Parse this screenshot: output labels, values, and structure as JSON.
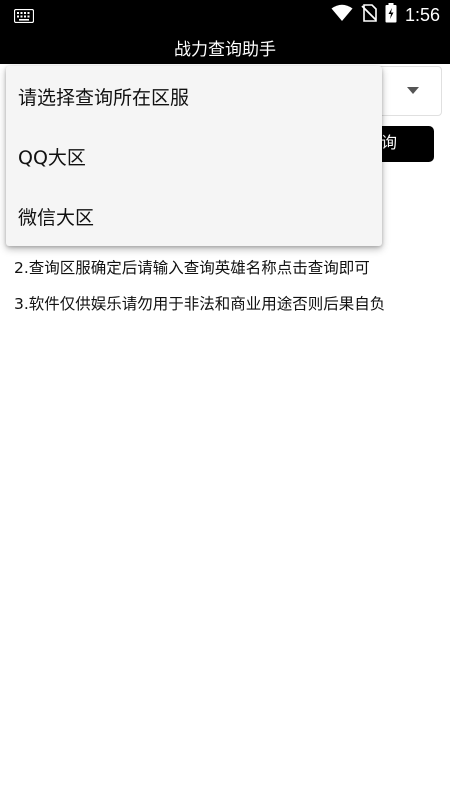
{
  "status_bar": {
    "time": "1:56",
    "icons": [
      "keyboard-icon",
      "wifi-icon",
      "no-sim-icon",
      "battery-charging-icon"
    ]
  },
  "app_bar": {
    "title": "战力查询助手"
  },
  "query_button": {
    "label": "查询",
    "visible_label": "询"
  },
  "instructions": [
    "2.查询区服确定后请输入查询英雄名称点击查询即可",
    "3.软件仅供娱乐请勿用于非法和商业用途否则后果自负"
  ],
  "dropdown": {
    "options": [
      "请选择查询所在区服",
      "QQ大区",
      "微信大区"
    ]
  },
  "colors": {
    "bar_background": "#000000",
    "popup_background": "#f5f5f5",
    "text": "#111111"
  }
}
